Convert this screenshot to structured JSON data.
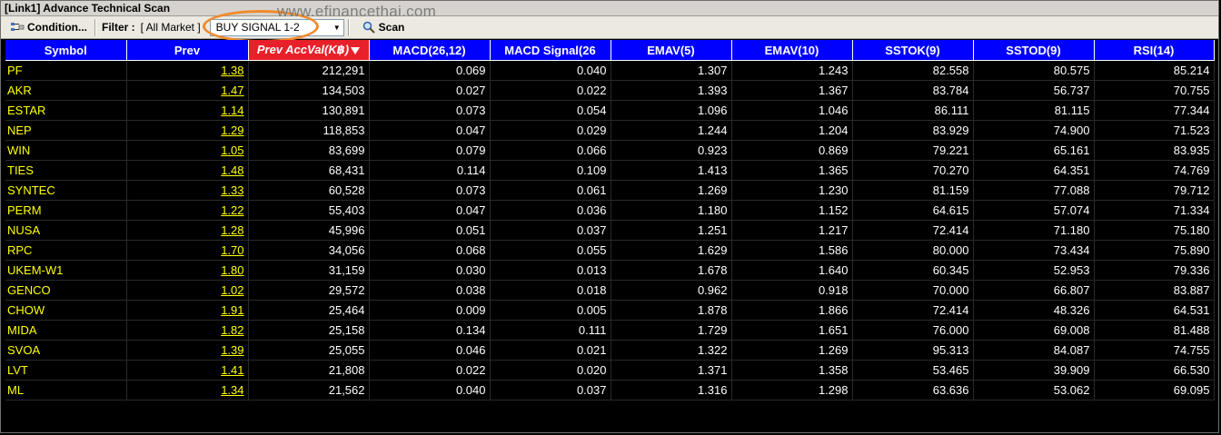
{
  "window": {
    "title": "[Link1] Advance Technical Scan"
  },
  "toolbar": {
    "condition_label": "Condition...",
    "filter_label": "Filter :",
    "filter_value": "[ All Market ]",
    "signal_value": "BUY SIGNAL 1-2",
    "scan_label": "Scan"
  },
  "watermark": "www.efinancethai.com",
  "colors": {
    "header_bg": "#0000ff",
    "sorted_header_bg": "#e8202a",
    "symbol_text": "#ffff00",
    "highlight_ring": "#f08a2c"
  },
  "table": {
    "columns": [
      "Symbol",
      "Prev",
      "Prev AccVal(K฿)",
      "MACD(26,12)",
      "MACD Signal(26",
      "EMAV(5)",
      "EMAV(10)",
      "SSTOK(9)",
      "SSTOD(9)",
      "RSI(14)"
    ],
    "rows": [
      [
        "PF",
        "1.38",
        "212,291",
        "0.069",
        "0.040",
        "1.307",
        "1.243",
        "82.558",
        "80.575",
        "85.214"
      ],
      [
        "AKR",
        "1.47",
        "134,503",
        "0.027",
        "0.022",
        "1.393",
        "1.367",
        "83.784",
        "56.737",
        "70.755"
      ],
      [
        "ESTAR",
        "1.14",
        "130,891",
        "0.073",
        "0.054",
        "1.096",
        "1.046",
        "86.111",
        "81.115",
        "77.344"
      ],
      [
        "NEP",
        "1.29",
        "118,853",
        "0.047",
        "0.029",
        "1.244",
        "1.204",
        "83.929",
        "74.900",
        "71.523"
      ],
      [
        "WIN",
        "1.05",
        "83,699",
        "0.079",
        "0.066",
        "0.923",
        "0.869",
        "79.221",
        "65.161",
        "83.935"
      ],
      [
        "TIES",
        "1.48",
        "68,431",
        "0.114",
        "0.109",
        "1.413",
        "1.365",
        "70.270",
        "64.351",
        "74.769"
      ],
      [
        "SYNTEC",
        "1.33",
        "60,528",
        "0.073",
        "0.061",
        "1.269",
        "1.230",
        "81.159",
        "77.088",
        "79.712"
      ],
      [
        "PERM",
        "1.22",
        "55,403",
        "0.047",
        "0.036",
        "1.180",
        "1.152",
        "64.615",
        "57.074",
        "71.334"
      ],
      [
        "NUSA",
        "1.28",
        "45,996",
        "0.051",
        "0.037",
        "1.251",
        "1.217",
        "72.414",
        "71.180",
        "75.180"
      ],
      [
        "RPC",
        "1.70",
        "34,056",
        "0.068",
        "0.055",
        "1.629",
        "1.586",
        "80.000",
        "73.434",
        "75.890"
      ],
      [
        "UKEM-W1",
        "1.80",
        "31,159",
        "0.030",
        "0.013",
        "1.678",
        "1.640",
        "60.345",
        "52.953",
        "79.336"
      ],
      [
        "GENCO",
        "1.02",
        "29,572",
        "0.038",
        "0.018",
        "0.962",
        "0.918",
        "70.000",
        "66.807",
        "83.887"
      ],
      [
        "CHOW",
        "1.91",
        "25,464",
        "0.009",
        "0.005",
        "1.878",
        "1.866",
        "72.414",
        "48.326",
        "64.531"
      ],
      [
        "MIDA",
        "1.82",
        "25,158",
        "0.134",
        "0.111",
        "1.729",
        "1.651",
        "76.000",
        "69.008",
        "81.488"
      ],
      [
        "SVOA",
        "1.39",
        "25,055",
        "0.046",
        "0.021",
        "1.322",
        "1.269",
        "95.313",
        "84.087",
        "74.755"
      ],
      [
        "LVT",
        "1.41",
        "21,808",
        "0.022",
        "0.020",
        "1.371",
        "1.358",
        "53.465",
        "39.909",
        "66.530"
      ],
      [
        "ML",
        "1.34",
        "21,562",
        "0.040",
        "0.037",
        "1.316",
        "1.298",
        "63.636",
        "53.062",
        "69.095"
      ]
    ]
  }
}
